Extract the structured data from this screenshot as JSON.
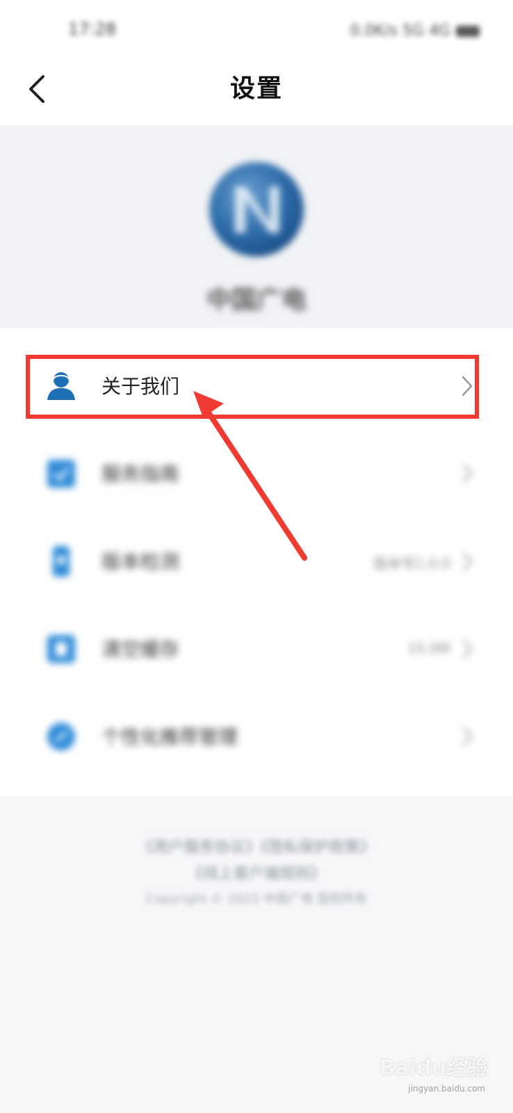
{
  "status_bar": {
    "time": "17:28",
    "indicators": "0.0K/s 5G 4G"
  },
  "header": {
    "title": "设置"
  },
  "profile": {
    "app_name": "中国广电"
  },
  "menu": {
    "items": [
      {
        "label": "关于我们",
        "value": "",
        "icon": "user-icon"
      },
      {
        "label": "服务指南",
        "value": "",
        "icon": "guide-icon"
      },
      {
        "label": "版本检测",
        "value": "版本号1.0.0",
        "icon": "version-icon"
      },
      {
        "label": "清空缓存",
        "value": "15.0M",
        "icon": "cache-icon"
      },
      {
        "label": "个性化推荐管理",
        "value": "",
        "icon": "recommend-icon"
      }
    ]
  },
  "footer": {
    "links_line1": "《用户服务协议》《隐私保护政策》",
    "links_line2": "《线上客户端规则》",
    "copyright": "Copyright © 2023 中国广电 版权所有"
  },
  "watermark": {
    "brand": "Baidu经验",
    "site": "jingyan.baidu.com"
  },
  "colors": {
    "highlight": "#f03a32",
    "icon_blue": "#1f6fb5"
  }
}
